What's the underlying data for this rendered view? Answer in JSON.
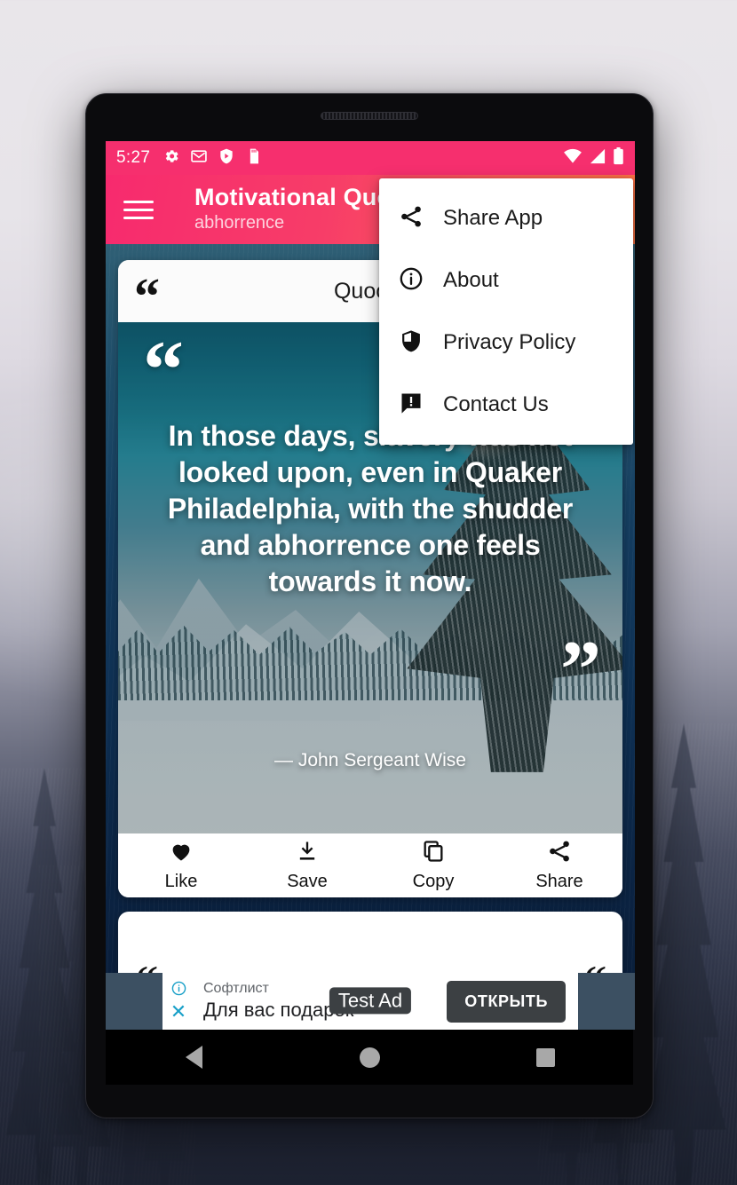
{
  "wallpaper": {
    "description": "misty winter forest"
  },
  "device": {
    "type": "android-tablet"
  },
  "statusbar": {
    "time": "5:27",
    "left_icons": [
      "gear-icon",
      "gmail-icon",
      "play-protect-icon",
      "sd-card-icon"
    ],
    "right_icons": [
      "wifi-icon",
      "cellular-signal-icon",
      "battery-icon"
    ]
  },
  "appbar": {
    "menu_icon": "hamburger-icon",
    "title": "Motivational Quotes",
    "subtitle": "abhorrence",
    "gradient_from": "#f72a6e",
    "gradient_to": "#fc7242"
  },
  "overflow_menu": {
    "items": [
      {
        "label": "Share App",
        "icon": "share-icon"
      },
      {
        "label": "About",
        "icon": "info-icon"
      },
      {
        "label": "Privacy Policy",
        "icon": "shield-icon"
      },
      {
        "label": "Contact Us",
        "icon": "feedback-icon"
      }
    ]
  },
  "quote_card": {
    "header_title": "Quoote",
    "open_quote_mark": "“",
    "close_quote_mark": "”",
    "text": "In those days, slavery was not looked upon, even in Quaker Philadelphia, with the shudder and abhorrence one feels towards it now.",
    "author": "— John Sergeant Wise",
    "actions": [
      {
        "label": "Like",
        "icon": "heart-icon"
      },
      {
        "label": "Save",
        "icon": "download-icon"
      },
      {
        "label": "Copy",
        "icon": "copy-icon"
      },
      {
        "label": "Share",
        "icon": "share-icon"
      }
    ]
  },
  "next_card": {
    "open_quote_mark": "“",
    "partial": true
  },
  "ad": {
    "info_icon": "info-icon",
    "close_icon": "close-icon",
    "brand": "Софтлист",
    "headline": "Для вас подарок",
    "badge": "Test Ad",
    "cta": "ОТКРЫТЬ"
  },
  "navbar": {
    "back": "back-button",
    "home": "home-button",
    "recents": "recents-button"
  }
}
